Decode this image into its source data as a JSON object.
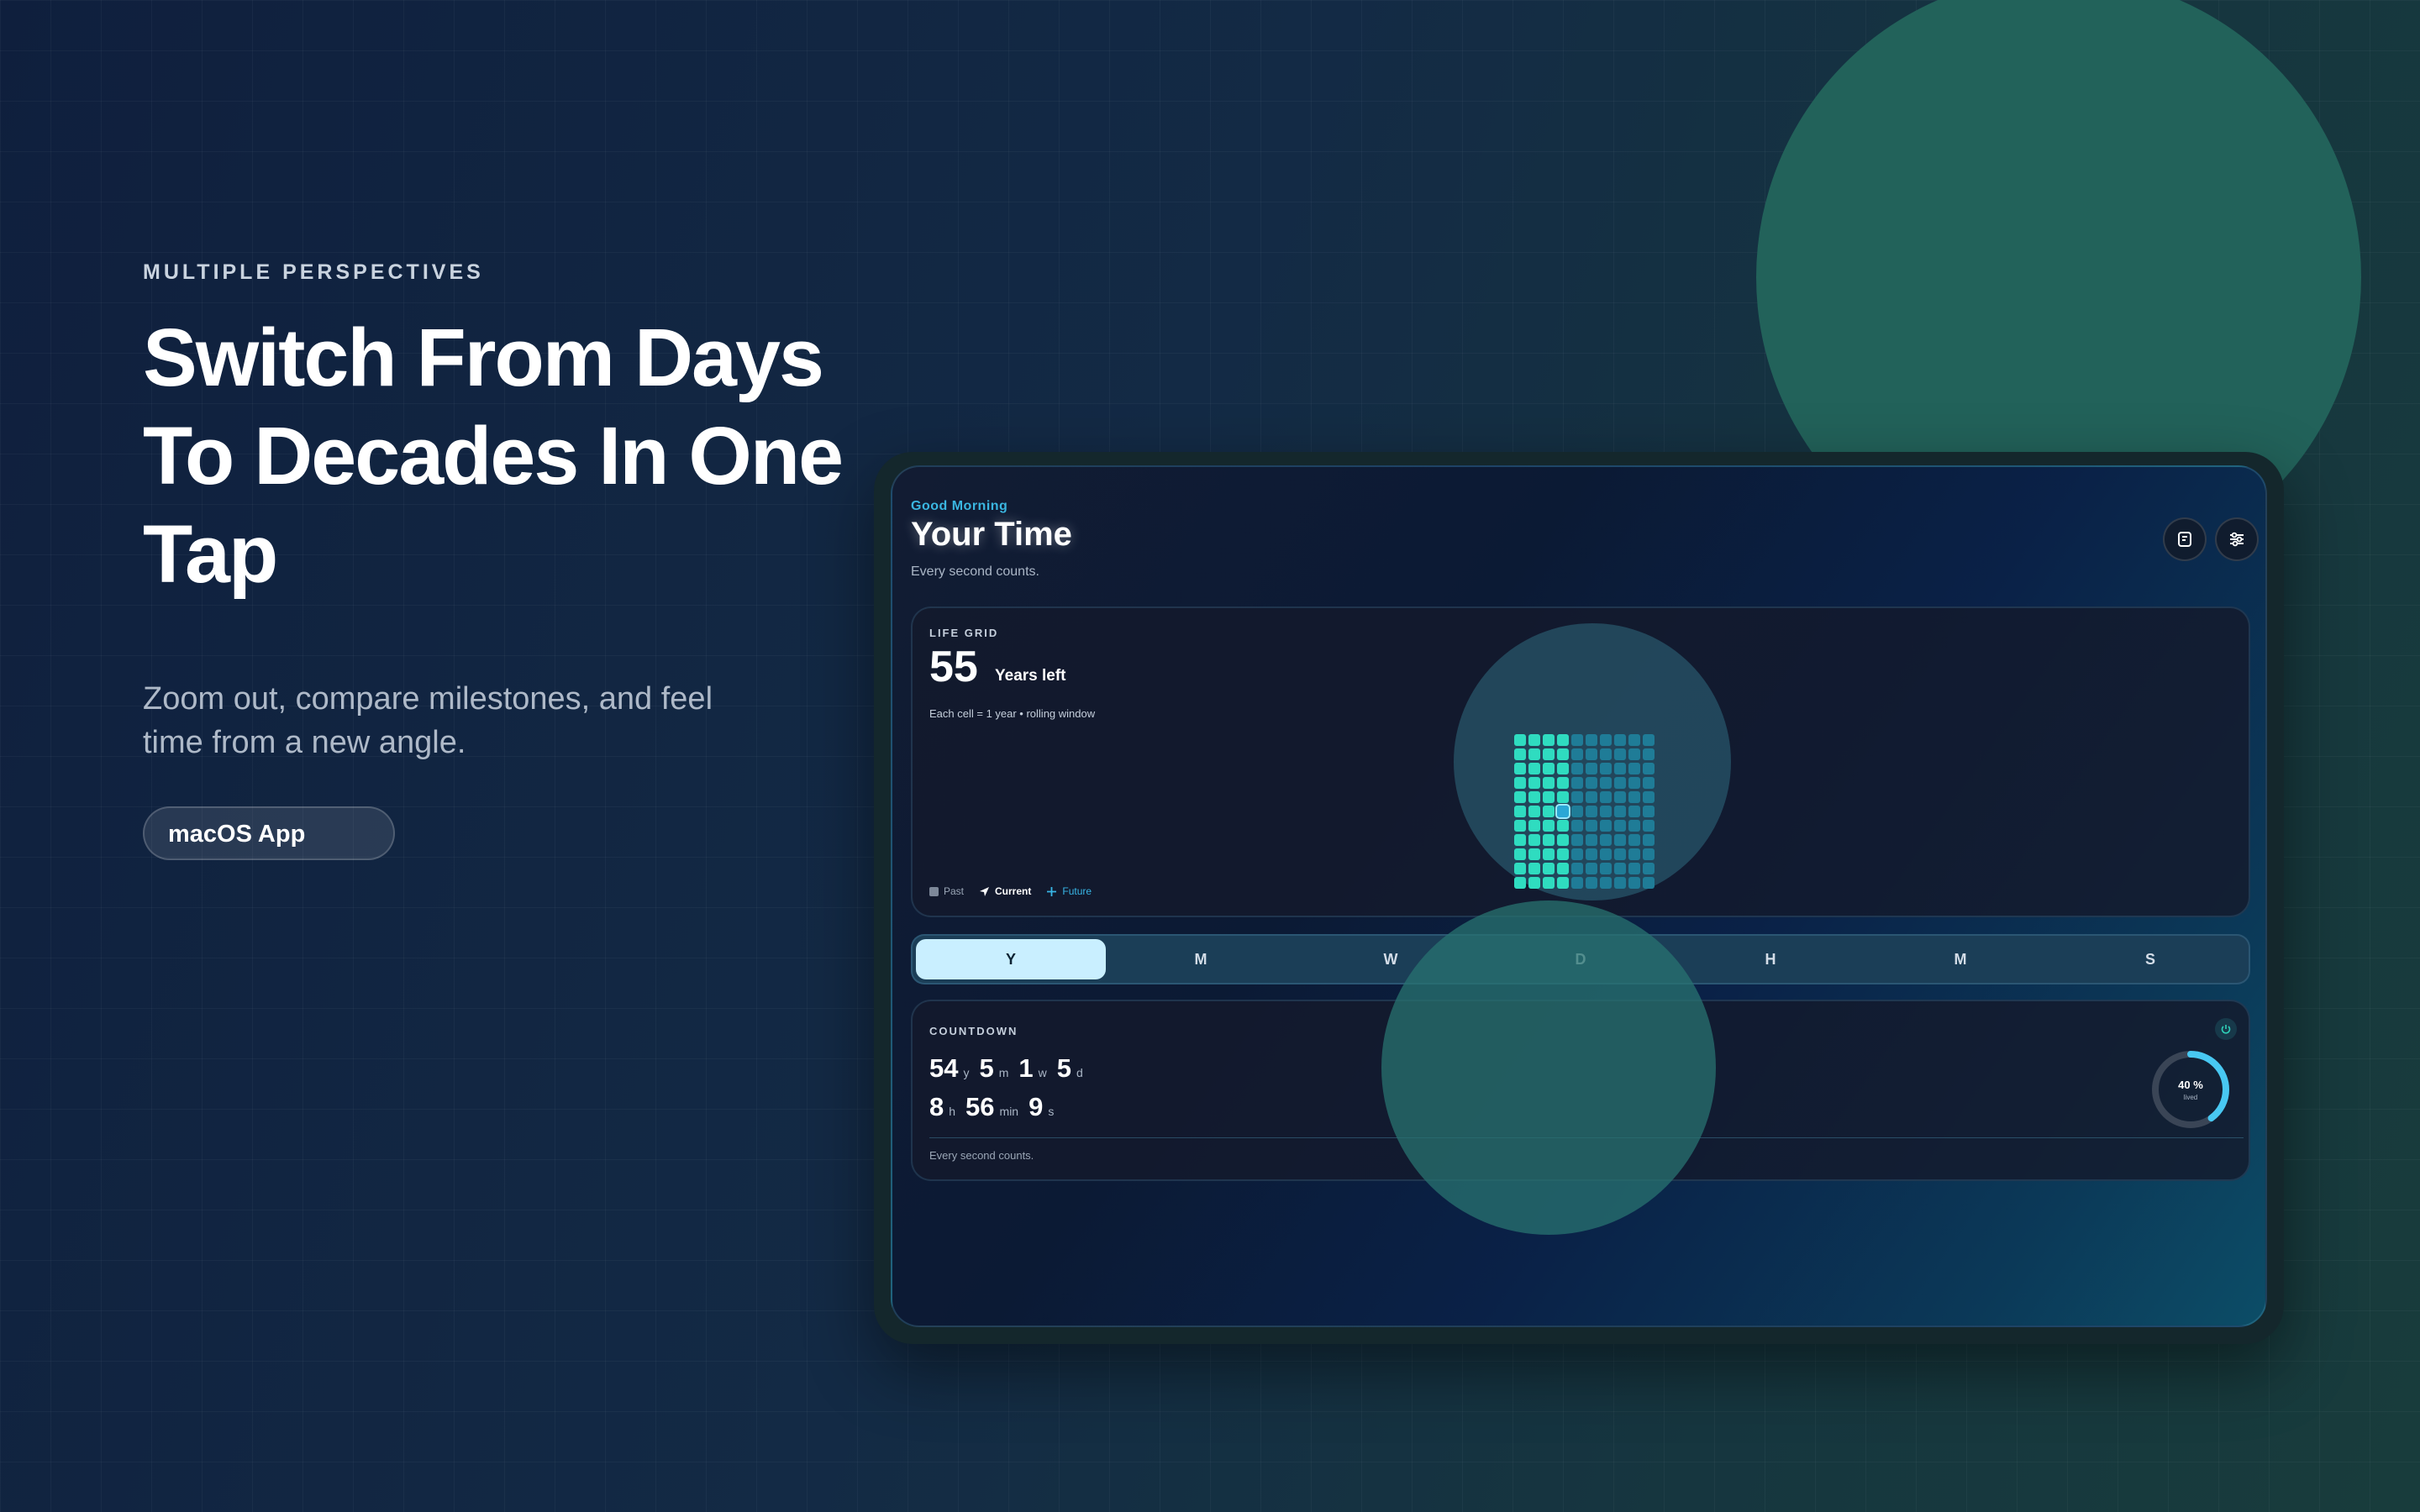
{
  "hero": {
    "eyebrow": "MULTIPLE PERSPECTIVES",
    "headline": "Switch From Days To Decades In One Tap",
    "subtext": "Zoom out, compare milestones, and feel time from a new angle.",
    "cta_label": "macOS App"
  },
  "app": {
    "greeting": "Good Morning",
    "title": "Your Time",
    "subtitle": "Every second counts.",
    "header_icons": [
      "note-icon",
      "sliders-icon"
    ]
  },
  "life_grid": {
    "label": "LIFE GRID",
    "value": "55",
    "unit": "Years left",
    "note": "Each cell = 1 year • rolling window",
    "legend": {
      "past": "Past",
      "current": "Current",
      "future": "Future"
    },
    "colors": {
      "past": "#2fdcc0",
      "future": "#1f7c97",
      "current": "#2aa7d6"
    }
  },
  "tabs": [
    {
      "label": "Y",
      "active": true
    },
    {
      "label": "M",
      "active": false
    },
    {
      "label": "W",
      "active": false
    },
    {
      "label": "D",
      "active": false
    },
    {
      "label": "H",
      "active": false
    },
    {
      "label": "M",
      "active": false
    },
    {
      "label": "S",
      "active": false
    }
  ],
  "countdown": {
    "label": "COUNTDOWN",
    "row1": [
      {
        "value": "54",
        "unit": "y"
      },
      {
        "value": "5",
        "unit": "m"
      },
      {
        "value": "1",
        "unit": "w"
      },
      {
        "value": "5",
        "unit": "d"
      }
    ],
    "row2": [
      {
        "value": "8",
        "unit": "h"
      },
      {
        "value": "56",
        "unit": "min"
      },
      {
        "value": "9",
        "unit": "s"
      }
    ],
    "footer": "Every second counts.",
    "progress_percent": 40,
    "progress_label": "40 %",
    "progress_sub": "lived"
  },
  "colors": {
    "accent": "#3ab6e0",
    "tab_active_bg": "#c9efff",
    "teal_blob": "#22625a"
  }
}
